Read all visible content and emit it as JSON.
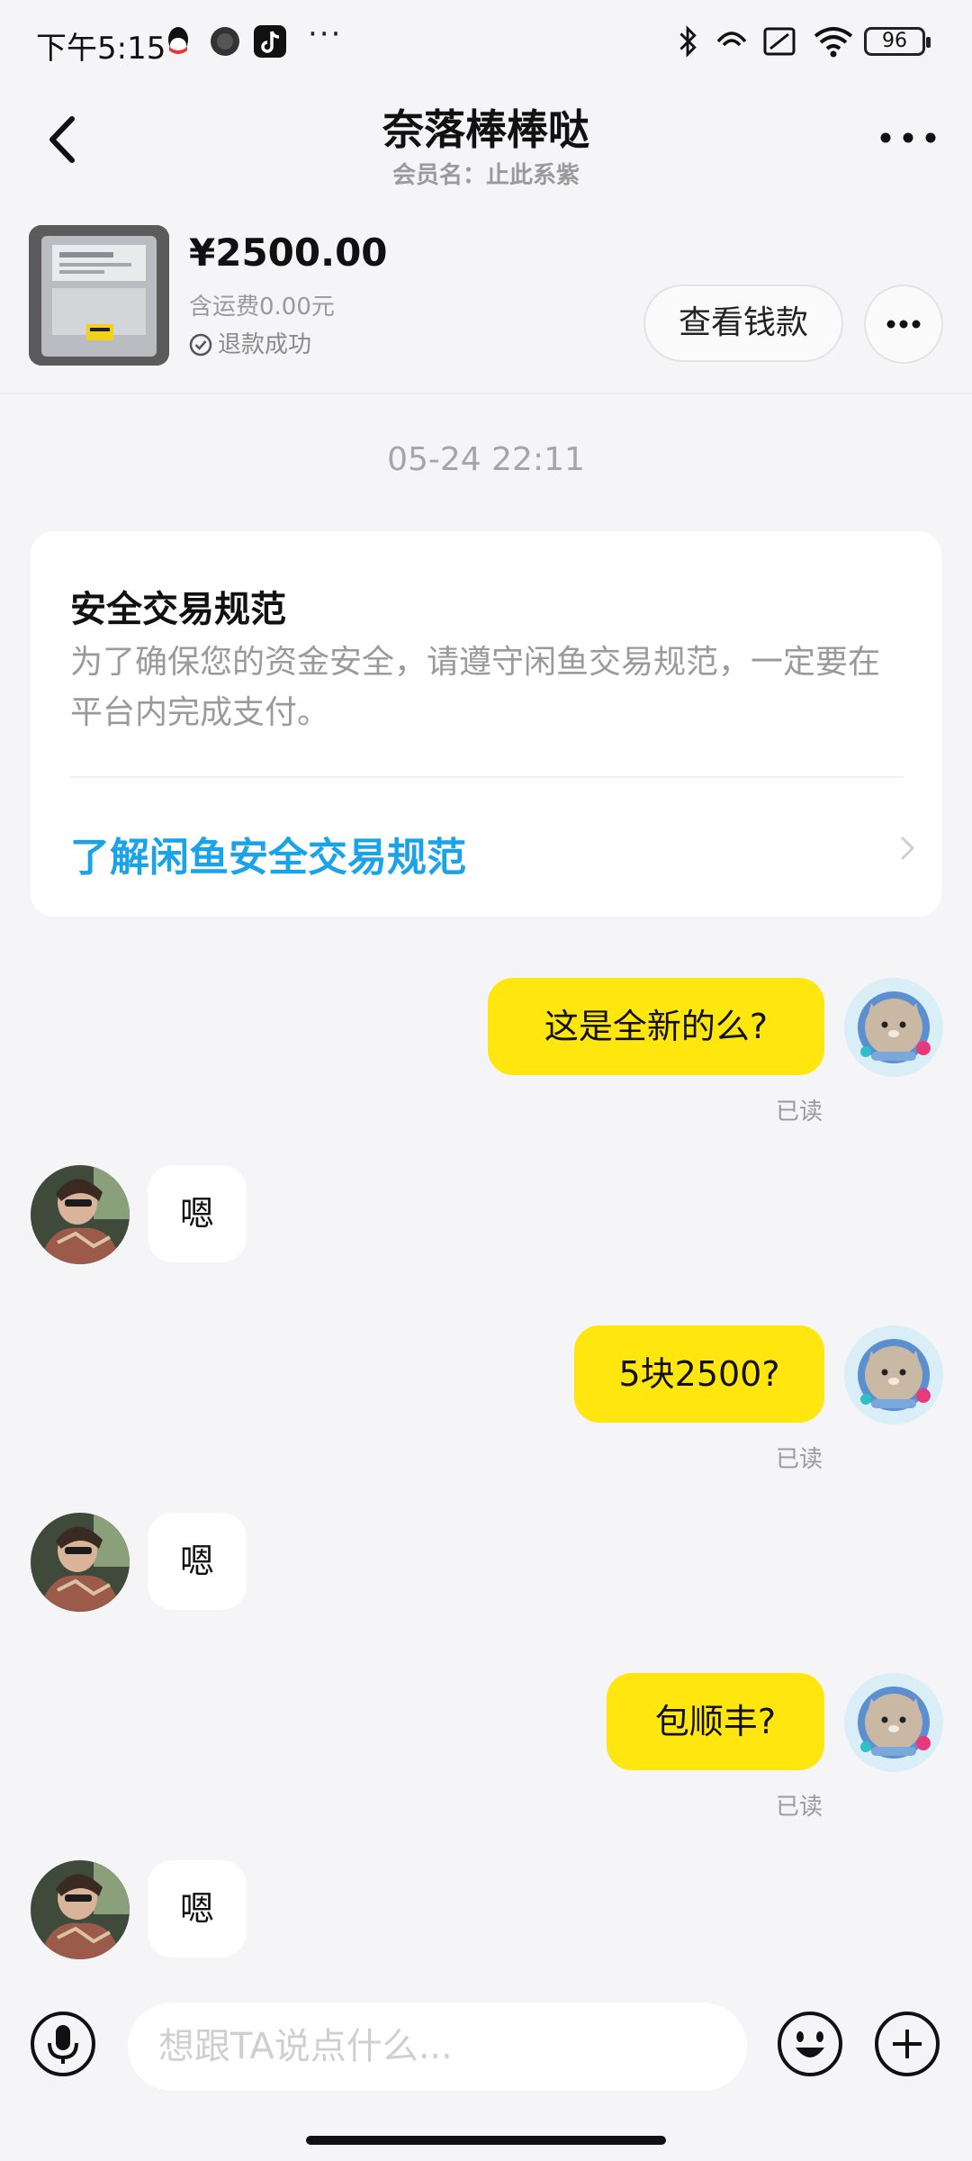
{
  "status_bar": {
    "time": "下午5:15",
    "overflow": "···",
    "battery": "96"
  },
  "header": {
    "title": "奈落棒棒哒",
    "subtitle": "会员名：止此系紫"
  },
  "product": {
    "price": "¥2500.00",
    "shipping": "含运费0.00元",
    "status": "退款成功",
    "view_money_label": "查看钱款"
  },
  "chat": {
    "timestamp": "05-24 22:11",
    "safety_card": {
      "title": "安全交易规范",
      "body": "为了确保您的资金安全，请遵守闲鱼交易规范，一定要在平台内完成支付。",
      "link": "了解闲鱼安全交易规范"
    },
    "messages": [
      {
        "side": "out",
        "text": "这是全新的么?",
        "read": "已读"
      },
      {
        "side": "in",
        "text": "嗯"
      },
      {
        "side": "out",
        "text": "5块2500?",
        "read": "已读"
      },
      {
        "side": "in",
        "text": "嗯"
      },
      {
        "side": "out",
        "text": "包顺丰?",
        "read": "已读"
      },
      {
        "side": "in",
        "text": "嗯"
      }
    ]
  },
  "input_bar": {
    "placeholder": "想跟TA说点什么..."
  },
  "colors": {
    "outgoing_bubble": "#ffe60f",
    "link": "#1aa3e8",
    "background": "#f5f5f7"
  },
  "icons": [
    "back-arrow-icon",
    "more-dots-icon",
    "check-circle-icon",
    "chevron-right-icon",
    "microphone-icon",
    "emoji-icon",
    "plus-icon"
  ]
}
